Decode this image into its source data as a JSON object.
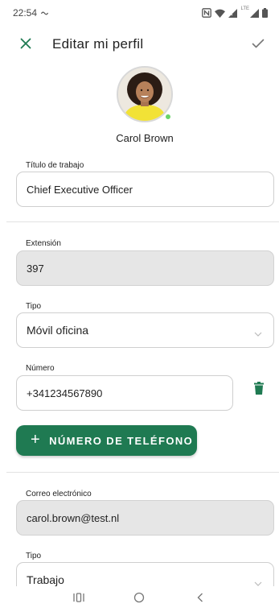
{
  "status_bar": {
    "time": "22:54",
    "left_icons": [
      "assistant-wave-icon"
    ],
    "right_icons": [
      "nfc-icon",
      "wifi-icon",
      "signal-icon",
      "lte-icon",
      "battery-icon"
    ],
    "lte_label": "LTE"
  },
  "app_bar": {
    "title": "Editar mi perfil",
    "close_icon": "close-icon",
    "save_icon": "check-icon"
  },
  "profile": {
    "name": "Carol Brown",
    "presence": "online",
    "presence_color": "#6ad46a"
  },
  "form": {
    "job_title": {
      "label": "Título de trabajo",
      "value": "Chief Executive Officer"
    },
    "extension": {
      "label": "Extensión",
      "value": "397"
    },
    "phone_type": {
      "label": "Tipo",
      "value": "Móvil oficina"
    },
    "phone_number": {
      "label": "Número",
      "value": "+341234567890"
    },
    "add_phone_label": "NÚMERO DE TELÉFONO",
    "email": {
      "label": "Correo electrónico",
      "value": "carol.brown@test.nl"
    },
    "email_type": {
      "label": "Tipo",
      "value": "Trabajo"
    }
  },
  "colors": {
    "accent": "#1f7a52",
    "disabled_field": "#e6e6e6"
  },
  "nav_bar": [
    "recent-apps-icon",
    "home-icon",
    "back-icon"
  ]
}
